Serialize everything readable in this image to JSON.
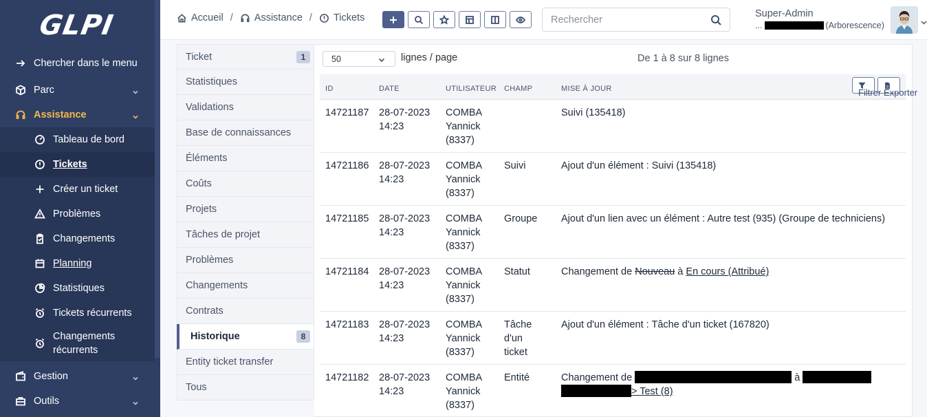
{
  "app": {
    "logo": "GLPI"
  },
  "sidebar": {
    "items": [
      {
        "label": "Chercher dans le menu",
        "icon": "arrow-right-icon"
      },
      {
        "label": "Parc",
        "icon": "box-icon"
      },
      {
        "label": "Assistance",
        "icon": "headset-icon"
      },
      {
        "label": "Tableau de bord",
        "icon": "dashboard-icon"
      },
      {
        "label": "Tickets",
        "icon": "alert-circle-icon"
      },
      {
        "label": "Créer un ticket",
        "icon": "plus-icon"
      },
      {
        "label": "Problèmes",
        "icon": "warning-icon"
      },
      {
        "label": "Changements",
        "icon": "clipboard-icon"
      },
      {
        "label": "Planning",
        "icon": "calendar-icon"
      },
      {
        "label": "Statistiques",
        "icon": "pie-chart-icon"
      },
      {
        "label": "Tickets récurrents",
        "icon": "alarm-icon"
      },
      {
        "label_line1": "Changements",
        "label_line2": "récurrents",
        "icon": "alarm-icon"
      },
      {
        "label": "Gestion",
        "icon": "wallet-icon"
      },
      {
        "label": "Outils",
        "icon": "briefcase-icon"
      }
    ]
  },
  "header": {
    "breadcrumb": [
      "Accueil",
      "Assistance",
      "Tickets"
    ],
    "search_placeholder": "Rechercher",
    "user_name": "Super-Admin",
    "user_entity_prefix": "...",
    "user_entity_suffix": "(Arborescence)"
  },
  "tabs": [
    {
      "label": "Ticket",
      "badge": "1"
    },
    {
      "label": "Statistiques"
    },
    {
      "label": "Validations"
    },
    {
      "label": "Base de connaissances"
    },
    {
      "label": "Éléments"
    },
    {
      "label": "Coûts"
    },
    {
      "label": "Projets"
    },
    {
      "label": "Tâches de projet"
    },
    {
      "label": "Problèmes"
    },
    {
      "label": "Changements"
    },
    {
      "label": "Contrats"
    },
    {
      "label": "Historique",
      "badge": "8",
      "active": true
    },
    {
      "label": "Entity ticket transfer"
    },
    {
      "label": "Tous"
    }
  ],
  "list": {
    "per_page": "50",
    "per_page_label": "lignes / page",
    "page_info": "De 1 à 8 sur 8 lignes",
    "columns": [
      "ID",
      "DATE",
      "UTILISATEUR",
      "CHAMP",
      "MISE À JOUR"
    ],
    "filter_label": "Filtrer",
    "export_label": "Exporter",
    "rows": [
      {
        "id": "14721187",
        "date1": "28-07-2023",
        "date2": "14:23",
        "user1": "COMBA",
        "user2": "Yannick",
        "user3": "(8337)",
        "field": "",
        "update": "Suivi (135418)"
      },
      {
        "id": "14721186",
        "date1": "28-07-2023",
        "date2": "14:23",
        "user1": "COMBA",
        "user2": "Yannick",
        "user3": "(8337)",
        "field": "Suivi",
        "update": "Ajout d'un élément : Suivi (135418)"
      },
      {
        "id": "14721185",
        "date1": "28-07-2023",
        "date2": "14:23",
        "user1": "COMBA",
        "user2": "Yannick",
        "user3": "(8337)",
        "field": "Groupe",
        "update": "Ajout d'un lien avec un élément : Autre test (935) (Groupe de techniciens)"
      },
      {
        "id": "14721184",
        "date1": "28-07-2023",
        "date2": "14:23",
        "user1": "COMBA",
        "user2": "Yannick",
        "user3": "(8337)",
        "field": "Statut",
        "update_prefix": "Changement de",
        "update_old": "Nouveau",
        "update_mid": "à",
        "update_new": "En cours (Attribué)"
      },
      {
        "id": "14721183",
        "date1": "28-07-2023",
        "date2": "14:23",
        "user1": "COMBA",
        "user2": "Yannick",
        "user3": "(8337)",
        "field1": "Tâche",
        "field2": "d'un",
        "field3": "ticket",
        "update": "Ajout d'un élément : Tâche d'un ticket (167820)"
      },
      {
        "id": "14721182",
        "date1": "28-07-2023",
        "date2": "14:23",
        "user1": "COMBA",
        "user2": "Yannick",
        "user3": "(8337)",
        "field": "Entité",
        "update_prefix": "Changement de",
        "update_mid": "à",
        "update_tail": "> Test (8)"
      }
    ]
  }
}
